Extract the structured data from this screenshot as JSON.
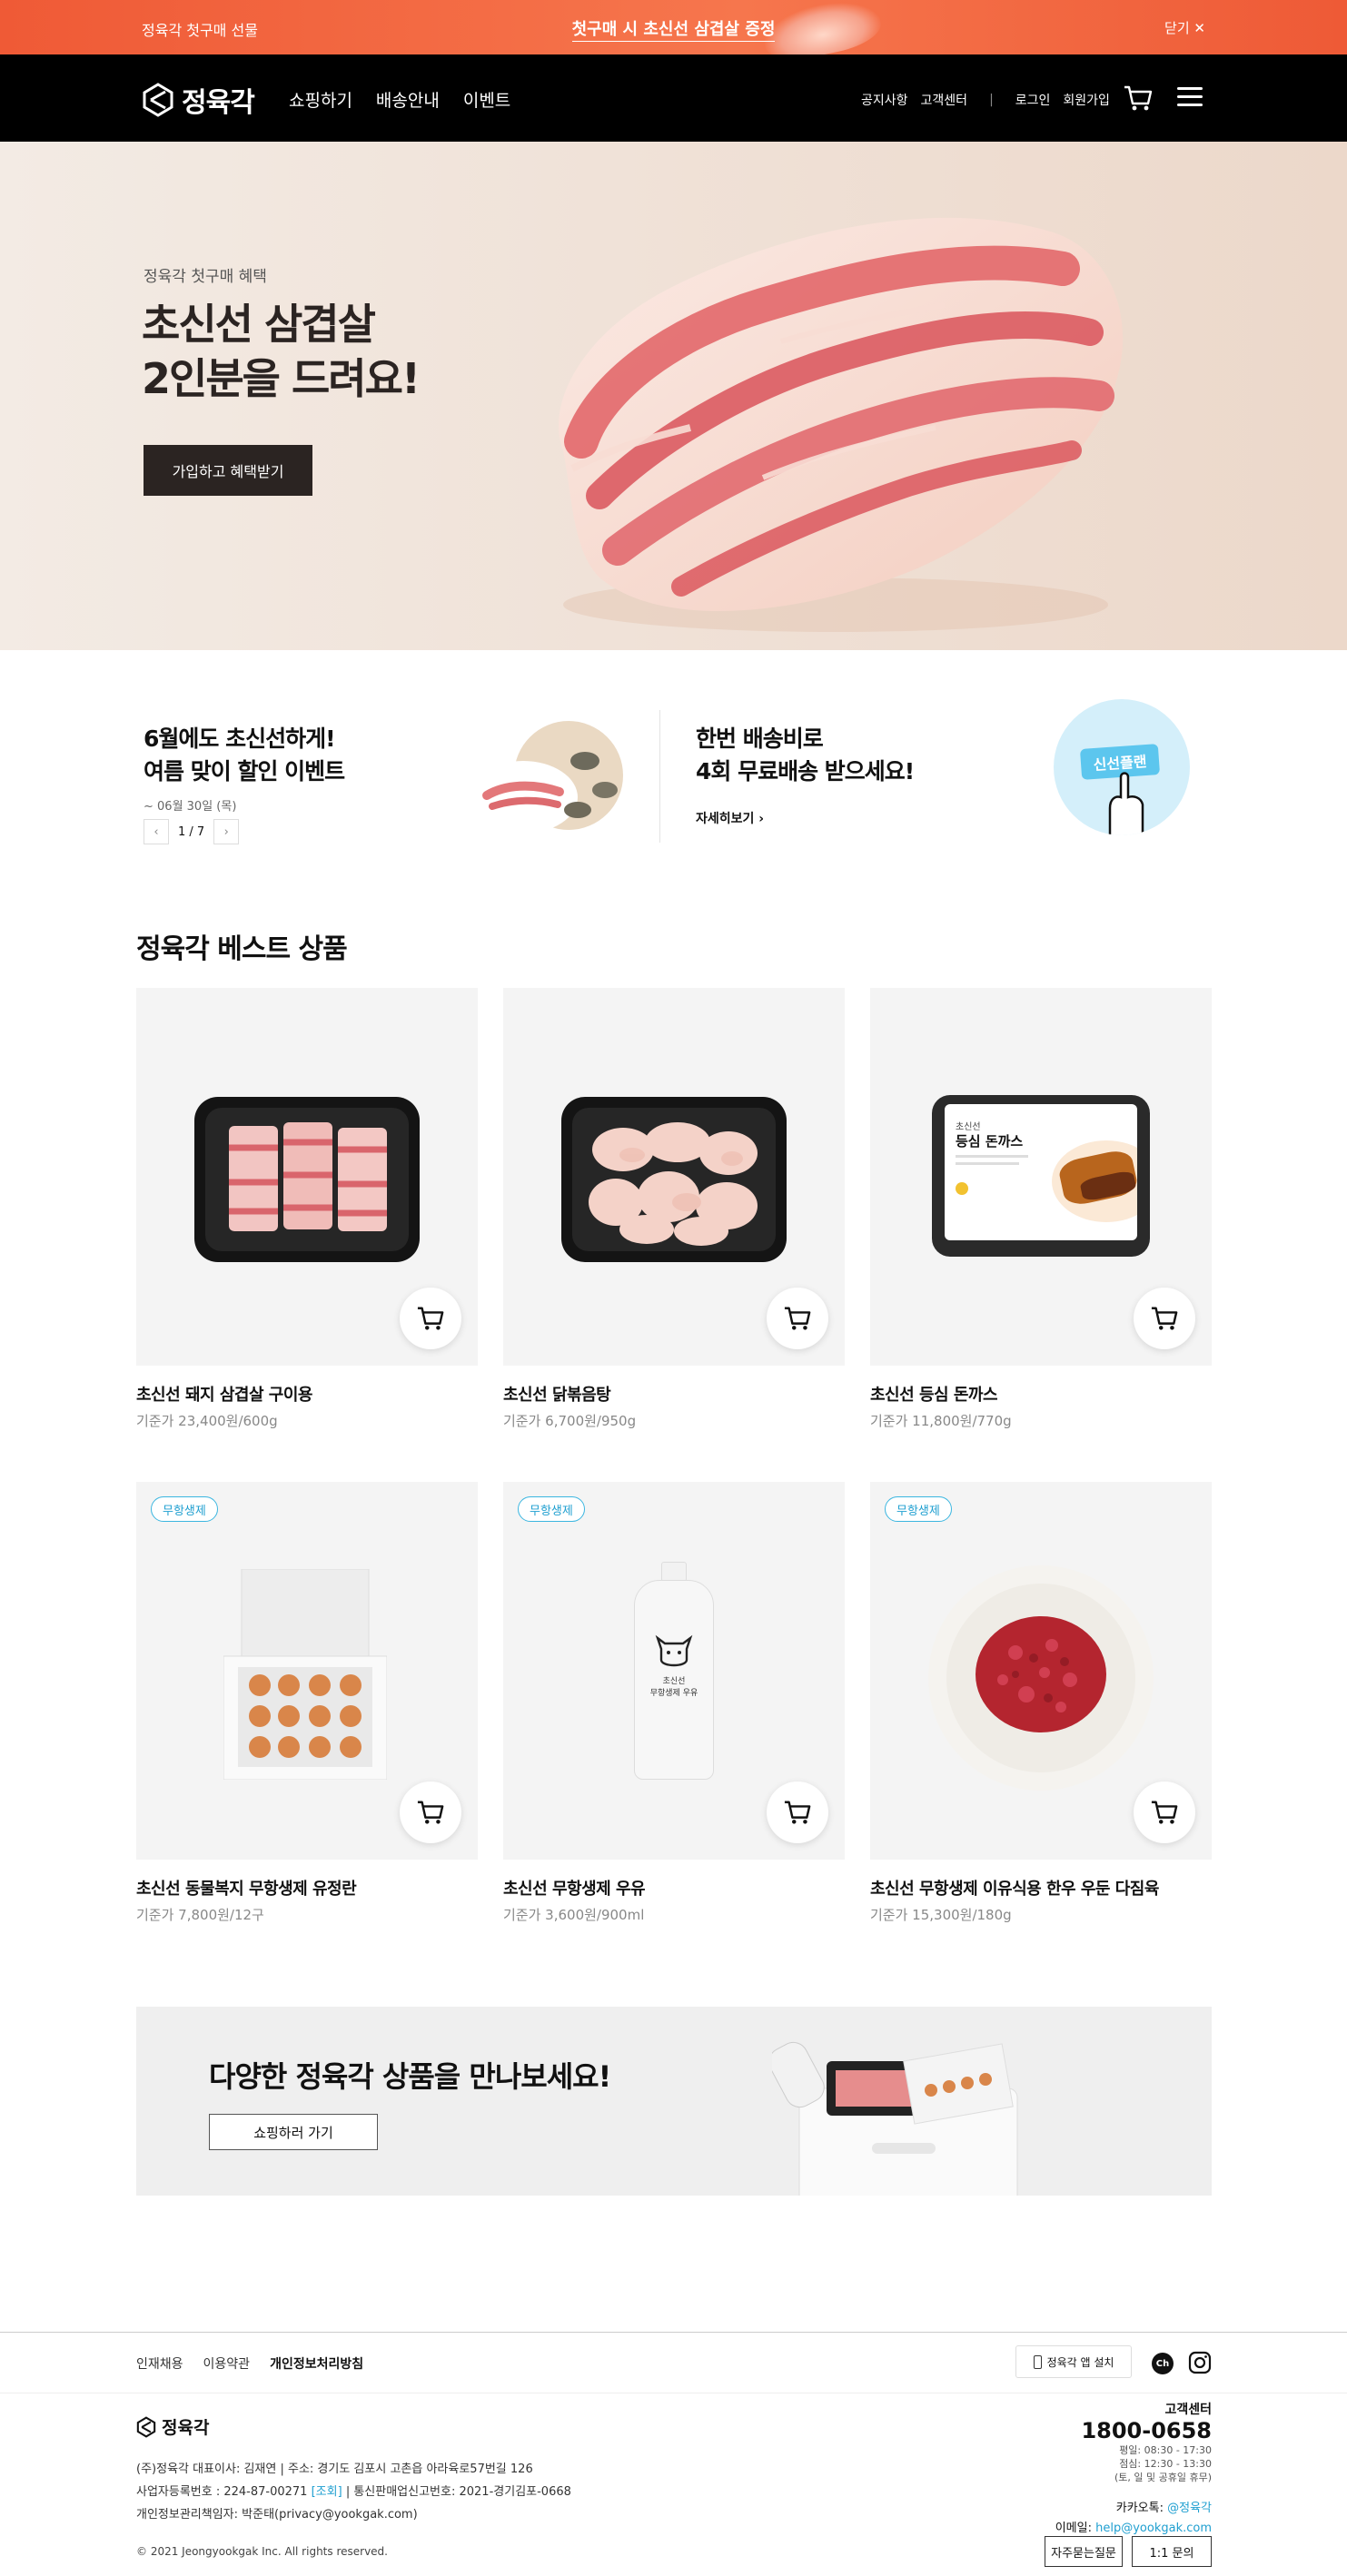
{
  "top_banner": {
    "left_text": "정육각 첫구매 선물",
    "center_text": "첫구매 시 초신선 삼겹살 증정",
    "close_label": "닫기"
  },
  "header": {
    "logo_text": "정육각",
    "nav": [
      "쇼핑하기",
      "배송안내",
      "이벤트"
    ],
    "util": [
      "공지사항",
      "고객센터",
      "로그인",
      "회원가입"
    ],
    "util_separator": "|"
  },
  "hero": {
    "eyebrow": "정육각 첫구매 혜택",
    "title": "초신선 삼겹살\n2인분을 드려요!",
    "cta": "가입하고 혜택받기"
  },
  "promo": {
    "event": {
      "title": "6월에도 초신선하게!\n여름 맞이 할인 이벤트",
      "date": "~ 06월 30일 (목)",
      "prev": "‹",
      "page": "1 / 7",
      "next": "›"
    },
    "delivery": {
      "title": "한번 배송비로\n4회 무료배송 받으세요!",
      "more": "자세히보기 ›",
      "ticket_label": "신선플랜"
    }
  },
  "best": {
    "title": "정육각 베스트 상품",
    "products": [
      {
        "name": "초신선 돼지 삼겹살 구이용",
        "price": "기준가 23,400원/600g",
        "badge": "",
        "image": "pork-belly-tray"
      },
      {
        "name": "초신선 닭볶음탕",
        "price": "기준가 6,700원/950g",
        "badge": "",
        "image": "chicken-tray"
      },
      {
        "name": "초신선 등심 돈까스",
        "price": "기준가 11,800원/770g",
        "badge": "",
        "image": "tonkatsu-pack",
        "pack_sub": "초신선",
        "pack_title": "등심 돈까스"
      },
      {
        "name": "초신선 동물복지 무항생제 유정란",
        "price": "기준가 7,800원/12구",
        "badge": "무항생제",
        "image": "egg-box"
      },
      {
        "name": "초신선 무항생제 우유",
        "price": "기준가 3,600원/900ml",
        "badge": "무항생제",
        "image": "milk-bottle",
        "bottle_label": "초신선\n무항생제 우유"
      },
      {
        "name": "초신선 무항생제 이유식용 한우 우둔 다짐육",
        "price": "기준가 15,300원/180g",
        "badge": "무항생제",
        "image": "minced-beef-plate"
      }
    ]
  },
  "banner": {
    "title": "다양한 정육각 상품을 만나보세요!",
    "button": "쇼핑하러 가기"
  },
  "footer": {
    "links": [
      "인재채용",
      "이용약관",
      "개인정보처리방침"
    ],
    "app_install": "정육각 앱 설치",
    "kakao_label": "Ch",
    "logo_text": "정육각",
    "company": "(주)정육각   대표이사: 김재연   |   주소: 경기도 김포시 고촌읍 아라육로57번길 126",
    "biz_no": "사업자등록번호 : 224-87-00271",
    "biz_check": "[조회]",
    "biz_rest": "|   통신판매업신고번호: 2021-경기김포-0668",
    "privacy_officer": "개인정보관리책임자: 박준태(privacy@yookgak.com)",
    "copyright": "© 2021 Jeongyookgak Inc. All rights reserved.",
    "cs_label": "고객센터",
    "cs_tel": "1800-0658",
    "cs_hours": "평일: 08:30 - 17:30\n점심: 12:30 - 13:30\n(토, 일 및 공휴일 휴무)",
    "kakao_talk_label": "카카오톡:",
    "kakao_talk": "@정육각",
    "email_label": "이메일:",
    "email": "help@yookgak.com",
    "faq": "자주묻는질문",
    "inquiry": "1:1 문의"
  },
  "colors": {
    "accent": "#ef5a36",
    "header_bg": "#000000",
    "badge": "#3bb6e0"
  }
}
